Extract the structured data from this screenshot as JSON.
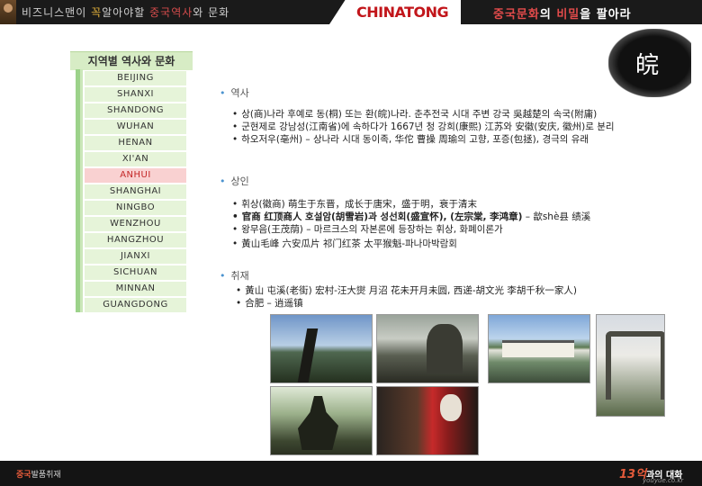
{
  "header": {
    "left_slogan_pre": "비즈니스맨이 ",
    "left_slogan_hl": "꼭",
    "left_slogan_mid": "알아야할",
    "left_slogan_hl2": "중국역사",
    "left_slogan_post": "와 문화",
    "logo": "CHINATONG",
    "right_slogan_a": "중국문화",
    "right_slogan_b": "의 ",
    "right_slogan_c": "비밀",
    "right_slogan_d": "을 팔아라"
  },
  "emblem_char": "皖",
  "sidebar": {
    "title": "지역별 역사와 문화",
    "items": [
      "BEIJING",
      "SHANXI",
      "SHANDONG",
      "WUHAN",
      "HENAN",
      "XI'AN",
      "ANHUI",
      "SHANGHAI",
      "NINGBO",
      "WENZHOU",
      "HANGZHOU",
      "JIANXI",
      "SICHUAN",
      "MINNAN",
      "GUANGDONG"
    ],
    "active": "ANHUI"
  },
  "sections": {
    "history": {
      "heading": "역사",
      "items": [
        "상(商)나라 후예로 동(桐) 또는 환(皖)나라. 춘추전국 시대 주변 강국 吳越楚의 속국(附庸)",
        "군현제로 강남성(江南省)에 속하다가 1667년 청 강희(康熙) 江苏와 安徽(安庆, 徽州)로 분리",
        "하오저우(亳州) – 상나라 시대 동이족, 华佗 曹操 周瑜의 고향, 포증(包拯), 경극의 유래"
      ]
    },
    "merchants": {
      "heading": "상인",
      "items": [
        "휘상(徽商)  萌生于东晋，成长于唐宋，盛于明，衰于清末",
        "왕무음(王茂荫) – 마르크스의 자본론에 등장하는 휘상, 화폐이론가",
        "黃山毛峰 六安瓜片 祁门红茶 太平猴魁-파나마박람회"
      ],
      "bold_item": "官商 红顶商人 호설암(胡雪岩)과 성선회(盛宣怀), (左宗棠, 李鸿章)",
      "bold_item_tail": " – 歙shè县 绩溪"
    },
    "coverage": {
      "heading": "취재",
      "items": [
        "黃山 屯溪(老街) 宏村-汪大爕 月沼 花未开月未圆,  西递-胡文光 李胡千秋一家人)",
        "合肥 – 逍遥镇"
      ]
    }
  },
  "footer": {
    "left_red": "중국",
    "left_white": "발품취재",
    "right_num": "13억",
    "right_text": "과의 대화",
    "url": "youyue.co.kr"
  }
}
